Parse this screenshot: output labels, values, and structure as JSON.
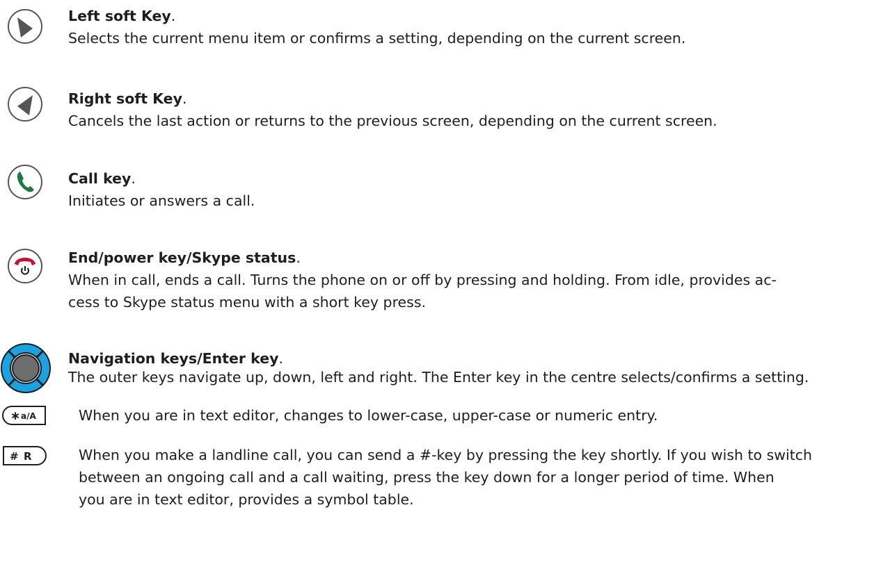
{
  "items": [
    {
      "title": "Left soft Key",
      "title_suffix": ".",
      "description": "Selects the current menu item or confirms a setting, depending on the current screen.",
      "icon": "left-soft-key-icon"
    },
    {
      "title": "Right soft Key",
      "title_suffix": ".",
      "description": "Cancels the last action or returns to the previous screen, depending on the current screen.",
      "icon": "right-soft-key-icon"
    },
    {
      "title": "Call key",
      "title_suffix": ".",
      "description": "Initiates or answers a call.",
      "icon": "call-key-icon"
    },
    {
      "title": "End/power key/Skype status",
      "title_suffix": ".",
      "description_lines": [
        "When in call, ends a call. Turns the phone on or off by pressing and holding. From idle, provides ac-",
        "cess to Skype status menu with a short key press."
      ],
      "icon": "end-power-key-icon"
    },
    {
      "title": "Navigation keys/Enter key",
      "title_suffix": ".",
      "description": "The outer keys navigate up, down, left and right. The Enter key in the centre selects/confirms a setting.",
      "icon": "navigation-keys-icon"
    },
    {
      "key_label": "∗ a/A",
      "description": "When you are in text editor, changes to lower-case, upper-case or numeric entry.",
      "icon": "star-key-icon"
    },
    {
      "key_label": "# R",
      "description_lines": [
        "When you make a landline call, you can send a #-key by pressing the key shortly. If you wish to switch",
        "between an ongoing call and a call waiting, press the key down for a longer period of time. When",
        "you are in text editor, provides a symbol table."
      ],
      "icon": "hash-key-icon"
    }
  ],
  "colors": {
    "text": "#1e1e1e",
    "icon_gray": "#555555",
    "call_green": "#1f7a3c",
    "end_red": "#c8102e",
    "nav_blue": "#19a3e0",
    "nav_center": "#6e6e6e"
  }
}
